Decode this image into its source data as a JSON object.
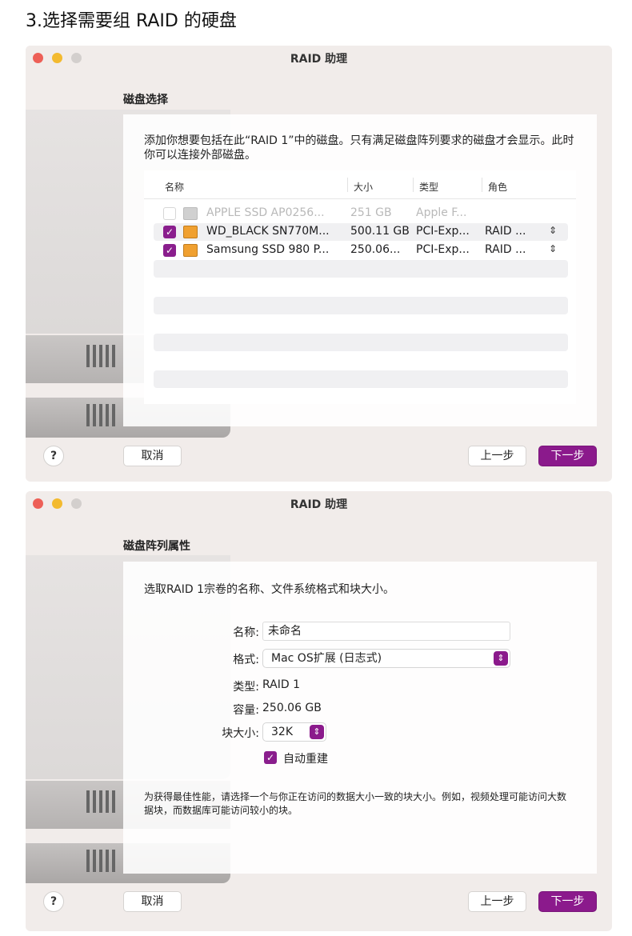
{
  "heading": "3.选择需要组 RAID 的硬盘",
  "window1": {
    "title": "RAID 助理",
    "section_title": "磁盘选择",
    "description": "添加你想要包括在此“RAID 1”中的磁盘。只有满足磁盘阵列要求的磁盘才会显示。此时你可以连接外部磁盘。",
    "columns": {
      "name": "名称",
      "size": "大小",
      "type": "类型",
      "role": "角色"
    },
    "rows": [
      {
        "name": "APPLE SSD AP0256...",
        "size": "251 GB",
        "type": "Apple F...",
        "role": "",
        "checked": false
      },
      {
        "name": "WD_BLACK SN770M...",
        "size": "500.11 GB",
        "type": "PCI-Exp...",
        "role": "RAID ...",
        "checked": true
      },
      {
        "name": "Samsung SSD 980 P...",
        "size": "250.06...",
        "type": "PCI-Exp...",
        "role": "RAID ...",
        "checked": true
      }
    ],
    "buttons": {
      "help": "?",
      "cancel": "取消",
      "back": "上一步",
      "next": "下一步"
    }
  },
  "window2": {
    "title": "RAID 助理",
    "section_title": "磁盘阵列属性",
    "description": "选取RAID 1宗卷的名称、文件系统格式和块大小。",
    "form": {
      "name_label": "名称:",
      "name_value": "未命名",
      "format_label": "格式:",
      "format_value": "Mac OS扩展 (日志式)",
      "type_label": "类型:",
      "type_value": "RAID 1",
      "capacity_label": "容量:",
      "capacity_value": "250.06 GB",
      "block_label": "块大小:",
      "block_value": "32K",
      "auto_rebuild_label": "自动重建",
      "auto_rebuild_checked": true
    },
    "hint": "为获得最佳性能，请选择一个与你正在访问的数据大小一致的块大小。例如，视频处理可能访问大数据块，而数据库可能访问较小的块。",
    "buttons": {
      "help": "?",
      "cancel": "取消",
      "back": "上一步",
      "next": "下一步"
    }
  },
  "colors": {
    "accent": "#8b1a8c",
    "window_bg": "#f1ecea",
    "close": "#ed5f57",
    "minimize": "#f3ba2f",
    "zoom_inactive": "#d3cfcd"
  },
  "icons": {
    "checkbox_checked": "checkmark-icon",
    "disk": "disk-icon",
    "stepper": "up-down-chevron-icon",
    "help": "question-mark-icon"
  }
}
